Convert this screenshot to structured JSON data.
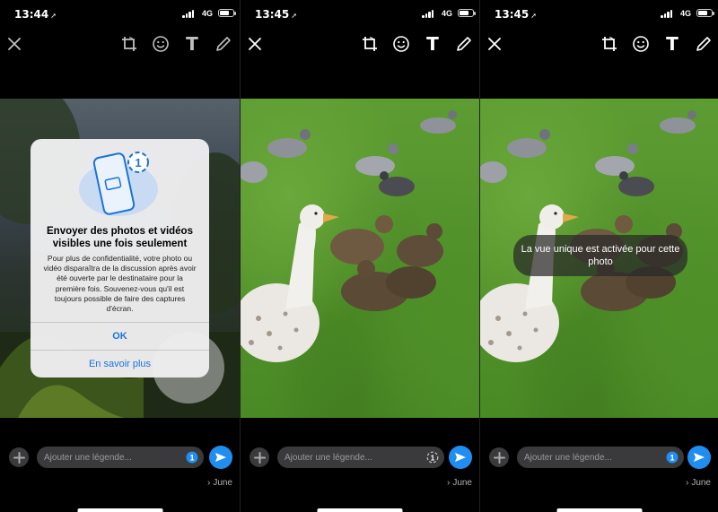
{
  "colors": {
    "accent": "#1f8ef0",
    "sheet_link": "#1a73d9",
    "badge": "#1f8ef0"
  },
  "panels": [
    {
      "status": {
        "time": "13:44",
        "network": "4G"
      },
      "toolbar_icons": [
        "close-icon",
        "crop-rotate-icon",
        "sticker-icon",
        "text-icon",
        "draw-icon"
      ],
      "sheet": {
        "title": "Envoyer des photos et vidéos visibles une fois seulement",
        "body": "Pour plus de confidentialité, votre photo ou vidéo disparaîtra de la discussion après avoir été ouverte par le destinataire pour la première fois. Souvenez-vous qu'il est toujours possible de faire des captures d'écran.",
        "illustration_badge": "1",
        "ok_label": "OK",
        "learn_more_label": "En savoir plus"
      },
      "composer": {
        "placeholder": "Ajouter une légende...",
        "view_once_label": "1"
      },
      "recipient": "June"
    },
    {
      "status": {
        "time": "13:45",
        "network": "4G"
      },
      "toolbar_icons": [
        "close-icon",
        "crop-rotate-icon",
        "sticker-icon",
        "text-icon",
        "draw-icon"
      ],
      "composer": {
        "placeholder": "Ajouter une légende...",
        "view_once_label": "1"
      },
      "recipient": "June"
    },
    {
      "status": {
        "time": "13:45",
        "network": "4G"
      },
      "toolbar_icons": [
        "close-icon",
        "crop-rotate-icon",
        "sticker-icon",
        "text-icon",
        "draw-icon"
      ],
      "toast": "La vue unique est activée pour cette photo",
      "composer": {
        "placeholder": "Ajouter une légende...",
        "view_once_label": "1"
      },
      "recipient": "June"
    }
  ]
}
